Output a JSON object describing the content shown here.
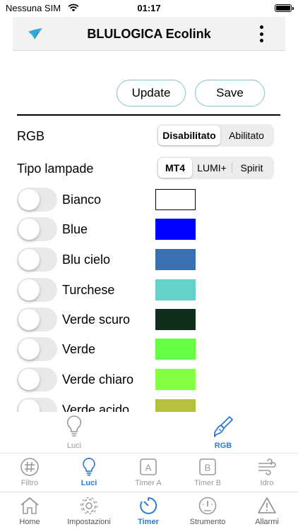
{
  "status": {
    "carrier": "Nessuna SIM",
    "time": "01:17"
  },
  "header": {
    "title": "BLULOGICA Ecolink",
    "logo_icon": "blulogica-logo"
  },
  "actions": {
    "update_label": "Update",
    "save_label": "Save"
  },
  "rgb": {
    "label": "RGB",
    "options": [
      "Disabilitato",
      "Abilitato"
    ],
    "selected": "Disabilitato"
  },
  "lamp": {
    "label": "Tipo lampade",
    "options": [
      "MT4",
      "LUMI+",
      "Spirit"
    ],
    "selected": "MT4"
  },
  "colors": [
    {
      "name": "Bianco",
      "swatch": "#ffffff",
      "on": false
    },
    {
      "name": "Blue",
      "swatch": "#0000ff",
      "on": false
    },
    {
      "name": "Blu cielo",
      "swatch": "#3a6fb0",
      "on": false
    },
    {
      "name": "Turchese",
      "swatch": "#66d1c9",
      "on": false
    },
    {
      "name": "Verde scuro",
      "swatch": "#0f2e1e",
      "on": false
    },
    {
      "name": "Verde",
      "swatch": "#66ff44",
      "on": false
    },
    {
      "name": "Verde chiaro",
      "swatch": "#86ff44",
      "on": false
    },
    {
      "name": "Verde acido",
      "swatch": "#b6c03c",
      "on": false
    }
  ],
  "subtabs": [
    {
      "label": "Luci",
      "icon": "bulb-icon",
      "active": false
    },
    {
      "label": "RGB",
      "icon": "brush-icon",
      "active": true
    }
  ],
  "tabbar_top": [
    {
      "label": "Filtro",
      "icon": "hash-icon",
      "active": false
    },
    {
      "label": "Luci",
      "icon": "bulb-icon",
      "active": true
    },
    {
      "label": "Timer A",
      "icon": "timer-a-icon",
      "active": false
    },
    {
      "label": "Timer B",
      "icon": "timer-b-icon",
      "active": false
    },
    {
      "label": "Idro",
      "icon": "wind-icon",
      "active": false
    }
  ],
  "tabbar_bottom": [
    {
      "label": "Home",
      "icon": "home-icon",
      "active": false
    },
    {
      "label": "Impostazioni",
      "icon": "gear-icon",
      "active": false
    },
    {
      "label": "Timer",
      "icon": "timer-icon",
      "active": true
    },
    {
      "label": "Strumento",
      "icon": "gauge-icon",
      "active": false
    },
    {
      "label": "Allarmi",
      "icon": "warning-icon",
      "active": false
    }
  ],
  "colors_theme": {
    "accent": "#2a7ad6",
    "button_border": "#7fc4d0",
    "inactive": "#9a9a9a"
  }
}
